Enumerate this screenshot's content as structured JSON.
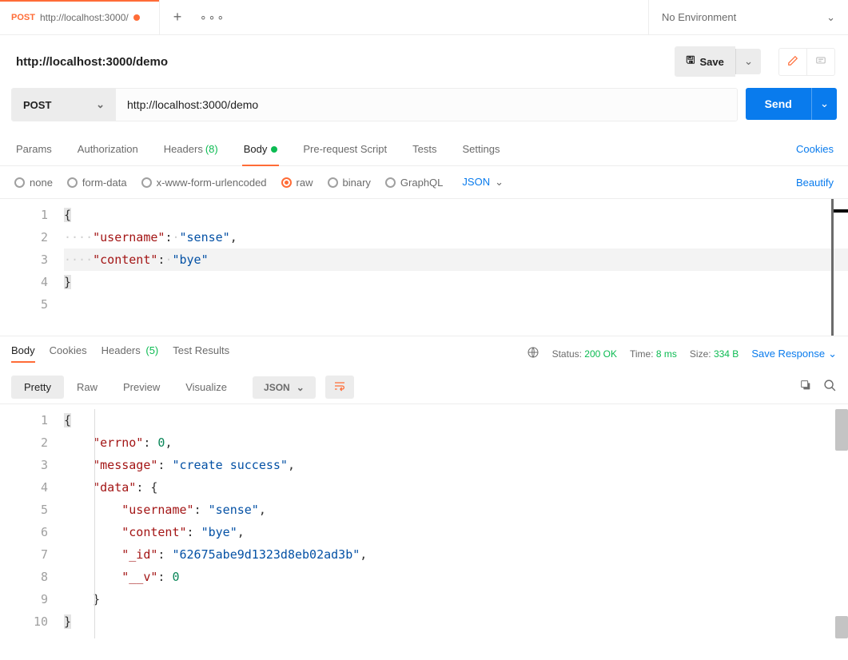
{
  "colors": {
    "accent_orange": "#ff6c37",
    "accent_blue": "#097bed",
    "success_green": "#0cbb52"
  },
  "tabs_strip": {
    "active_tab": {
      "method": "POST",
      "title": "http://localhost:3000/"
    }
  },
  "env_selector": {
    "label": "No Environment"
  },
  "request": {
    "name": "http://localhost:3000/demo",
    "save_label": "Save",
    "method": "POST",
    "url": "http://localhost:3000/demo",
    "send_label": "Send"
  },
  "subtabs": {
    "params": "Params",
    "authorization": "Authorization",
    "headers_label": "Headers",
    "headers_count": "(8)",
    "body": "Body",
    "prerequest": "Pre-request Script",
    "tests": "Tests",
    "settings": "Settings",
    "cookies": "Cookies"
  },
  "body_types": {
    "none": "none",
    "form_data": "form-data",
    "x_www": "x-www-form-urlencoded",
    "raw": "raw",
    "binary": "binary",
    "graphql": "GraphQL",
    "format": "JSON",
    "beautify": "Beautify"
  },
  "request_body": {
    "lines": [
      "1",
      "2",
      "3",
      "4",
      "5"
    ],
    "username_key": "\"username\"",
    "username_val": "\"sense\"",
    "content_key": "\"content\"",
    "content_val": "\"bye\""
  },
  "response": {
    "tabs": {
      "body": "Body",
      "cookies": "Cookies",
      "headers_label": "Headers",
      "headers_count": "(5)",
      "test_results": "Test Results"
    },
    "status_label": "Status:",
    "status_value": "200 OK",
    "time_label": "Time:",
    "time_value": "8 ms",
    "size_label": "Size:",
    "size_value": "334 B",
    "save_response": "Save Response",
    "view": {
      "pretty": "Pretty",
      "raw": "Raw",
      "preview": "Preview",
      "visualize": "Visualize",
      "format": "JSON"
    },
    "body_lines": [
      "1",
      "2",
      "3",
      "4",
      "5",
      "6",
      "7",
      "8",
      "9",
      "10"
    ],
    "body": {
      "errno_key": "\"errno\"",
      "errno_val": "0",
      "message_key": "\"message\"",
      "message_val": "\"create success\"",
      "data_key": "\"data\"",
      "username_key": "\"username\"",
      "username_val": "\"sense\"",
      "content_key": "\"content\"",
      "content_val": "\"bye\"",
      "id_key": "\"_id\"",
      "id_val": "\"62675abe9d1323d8eb02ad3b\"",
      "v_key": "\"__v\"",
      "v_val": "0"
    }
  }
}
